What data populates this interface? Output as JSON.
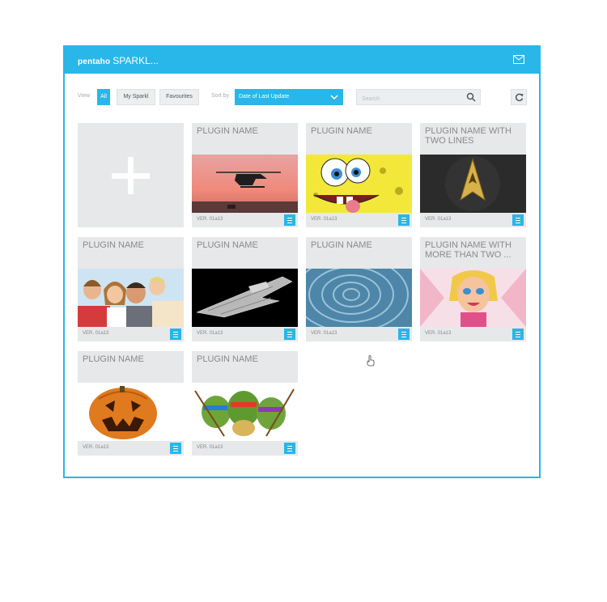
{
  "header": {
    "brand": "pentaho",
    "app_name": "SPARKL..."
  },
  "toolbar": {
    "view_label": "View",
    "filters": [
      {
        "label": "All",
        "active": true
      },
      {
        "label": "My Sparkl",
        "active": false
      },
      {
        "label": "Favourites",
        "active": false
      }
    ],
    "sort_label": "Sort by",
    "sort_value": "Date of Last Update",
    "search_placeholder": "Search"
  },
  "plugins": [
    {
      "name": "PLUGIN NAME",
      "version": "VER. 01a13",
      "image": "helicopter-sunset"
    },
    {
      "name": "PLUGIN NAME",
      "version": "VER. 01a13",
      "image": "spongebob"
    },
    {
      "name": "PLUGIN NAME WITH TWO LINES",
      "version": "VER. 01a13",
      "image": "starfleet-badge"
    },
    {
      "name": "PLUGIN NAME",
      "version": "VER. 01a13",
      "image": "family"
    },
    {
      "name": "PLUGIN NAME",
      "version": "VER. 01a13",
      "image": "star-destroyer"
    },
    {
      "name": "PLUGIN NAME",
      "version": "VER. 01a13",
      "image": "blue-swirl-texture"
    },
    {
      "name": "PLUGIN NAME WITH MORE THAN TWO ...",
      "version": "VER. 01a13",
      "image": "cartoon-girl"
    },
    {
      "name": "PLUGIN NAME",
      "version": "VER. 01a13",
      "image": "jack-o-lantern"
    },
    {
      "name": "PLUGIN NAME",
      "version": "VER. 01a13",
      "image": "ninja-turtles"
    }
  ],
  "colors": {
    "accent": "#29b6e8",
    "card_bg": "#e6e8ea"
  }
}
